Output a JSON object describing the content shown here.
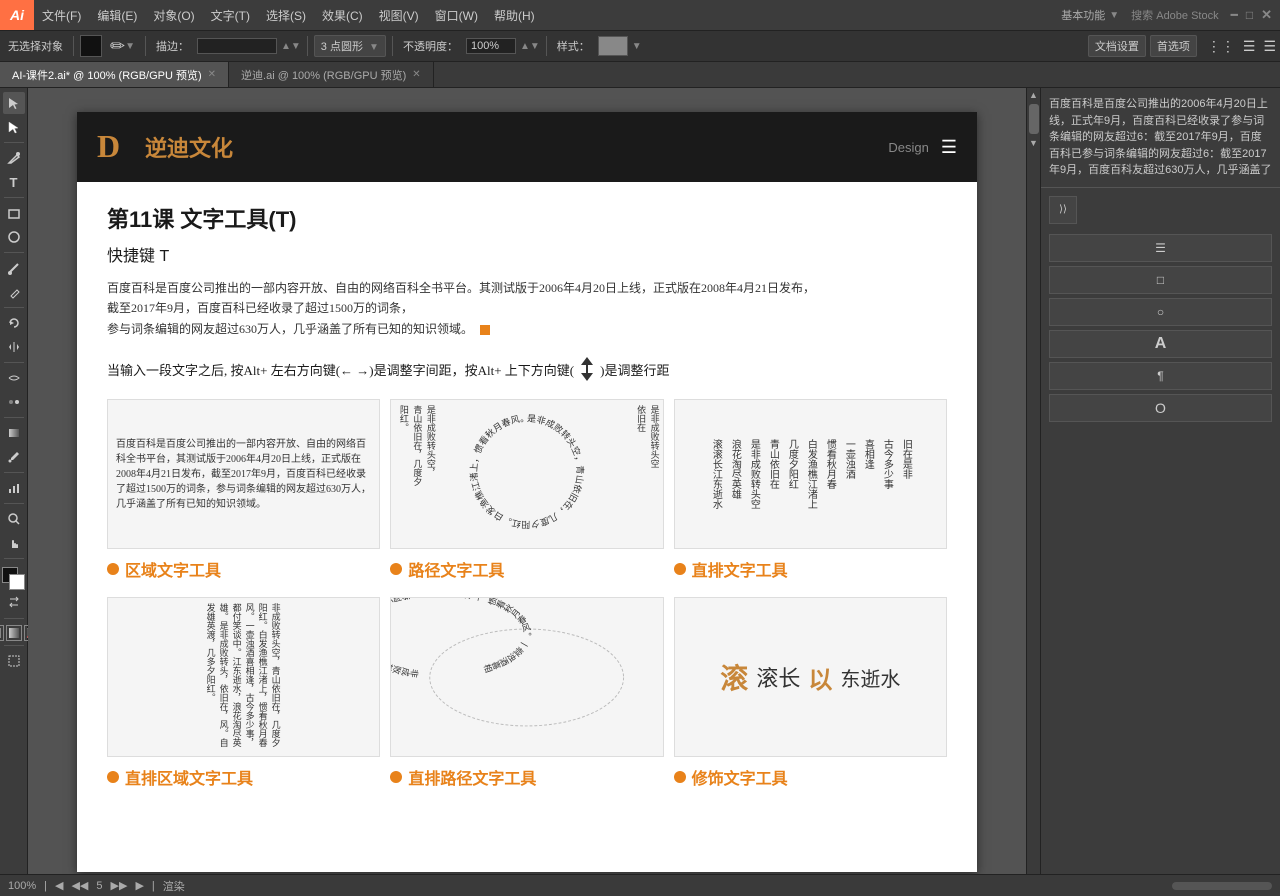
{
  "app": {
    "logo": "Ai",
    "menus": [
      "文件(F)",
      "编辑(E)",
      "对象(O)",
      "文字(T)",
      "选择(S)",
      "效果(C)",
      "视图(V)",
      "窗口(W)",
      "帮助(H)"
    ],
    "right_controls": [
      "基本功能",
      "搜索 Adobe Stock"
    ]
  },
  "toolbar": {
    "no_selection": "无选择对象",
    "brush_size": "描边：",
    "points": "3 点圆形",
    "opacity_label": "不透明度：",
    "opacity_value": "100%",
    "style_label": "样式：",
    "doc_settings": "文档设置",
    "preferences": "首选项"
  },
  "tabs": [
    {
      "label": "AI-课件2.ai* @ 100% (RGB/GPU 预览)",
      "active": true
    },
    {
      "label": "逆迪.ai @ 100% (RGB/GPU 预览)",
      "active": false
    }
  ],
  "document": {
    "header": {
      "logo_text": "逆迪文化",
      "design_label": "Design"
    },
    "lesson_title": "第11课   文字工具(T)",
    "shortcut": "快捷键 T",
    "description": "百度百科是百度公司推出的一部内容开放、自由的网络百科全书平台。其测试版于2006年4月20日上线，正式版在2008年4月21日发布，截至2017年9月，百度百科已经收录了超过1500万的词条，\n参与词条编辑的网友超过630万人，几乎涵盖了所有已知的知识领域。",
    "tip": "当输入一段文字之后, 按Alt+ 左右方向键(← →)是调整字间距，按Alt+ 上下方向键(",
    "tip2": ")是调整行距",
    "tools": [
      {
        "label": "区域文字工具",
        "type": "area"
      },
      {
        "label": "路径文字工具",
        "type": "path"
      },
      {
        "label": "直排文字工具",
        "type": "vertical"
      }
    ],
    "tools_bottom": [
      {
        "label": "直排区域文字工具",
        "type": "vert-area"
      },
      {
        "label": "直排路径文字工具",
        "type": "vert-path"
      },
      {
        "label": "修饰文字工具",
        "type": "decor"
      }
    ],
    "sample_poem": "非成败转头空，青山依旧在，几度夕阳红。白发渔樵江渚上，惯看秋月春风。一壶浊酒喜相逢，古今多少事，都付笑谈中。",
    "right_panel_text": "百度百科是百度公司推出的2006年4月20日上线，正式年9月，百度百科已经收录了参与词条编辑的网友超过6：截至2017年9月，百度百科已参与词条编辑的网友超过6：截至2017年9月，百度百科友超过630万人，几乎涵盖了"
  },
  "status": {
    "zoom": "100%",
    "page_info": "5",
    "render": "渲染"
  }
}
